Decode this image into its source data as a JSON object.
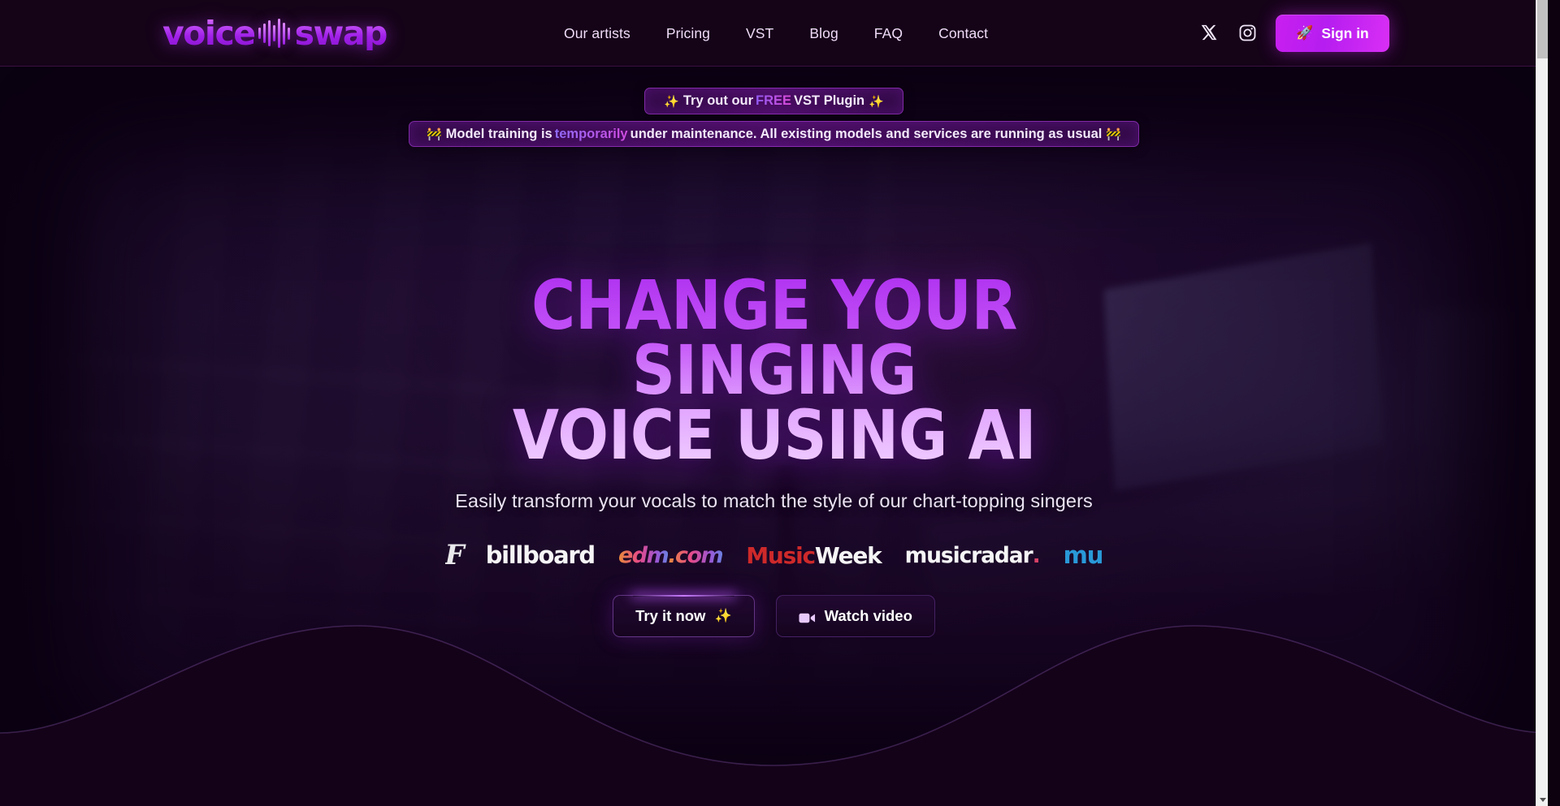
{
  "header": {
    "logo": {
      "word1": "voice",
      "word2": "swap",
      "icon": "waveform-icon"
    },
    "nav": [
      {
        "label": "Our artists"
      },
      {
        "label": "Pricing"
      },
      {
        "label": "VST"
      },
      {
        "label": "Blog"
      },
      {
        "label": "FAQ"
      },
      {
        "label": "Contact"
      }
    ],
    "socials": [
      {
        "name": "x-twitter-icon"
      },
      {
        "name": "instagram-icon"
      },
      {
        "name": "discord-icon"
      }
    ],
    "signin": {
      "label": "Sign in",
      "icon": "rocket-icon",
      "glyph": "🚀"
    },
    "colors": {
      "bg": "#150318",
      "accent": "#c81ff0",
      "nav_text": "#efdcf7"
    }
  },
  "banners": {
    "vst": {
      "emoji_left": "✨",
      "text_before": "Try out our ",
      "highlight": "FREE",
      "text_after": " VST Plugin ",
      "emoji_right": "✨"
    },
    "maintenance": {
      "emoji_left": "🚧",
      "text_before": "Model training is ",
      "highlight": "temporarily",
      "text_after": " under maintenance. All existing models and services are running as usual ",
      "emoji_right": "🚧"
    }
  },
  "hero": {
    "headline_line1": "Change your singing",
    "headline_line2": "voice using AI",
    "subtitle": "Easily transform your vocals to match the style of our chart-topping singers",
    "press_logos": [
      {
        "name": "forbes-logo",
        "text": "F"
      },
      {
        "name": "billboard-logo",
        "text": "billboard"
      },
      {
        "name": "edm-logo",
        "text": "edm",
        "suffix": ".com"
      },
      {
        "name": "musicweek-logo",
        "text1": "Music",
        "text2": "Week"
      },
      {
        "name": "musicradar-logo",
        "text": "musicradar",
        "dot": "."
      },
      {
        "name": "mu-logo",
        "text": "mu"
      }
    ],
    "cta_primary": {
      "label": "Try it now",
      "emoji": "✨"
    },
    "cta_secondary": {
      "label": "Watch video",
      "icon": "video-camera-icon"
    },
    "colors": {
      "headline_gradient_from": "#b032f0",
      "headline_gradient_to": "#f0cdff",
      "subtitle": "#eae3f2"
    }
  },
  "scrollbar": {
    "position": "top"
  }
}
